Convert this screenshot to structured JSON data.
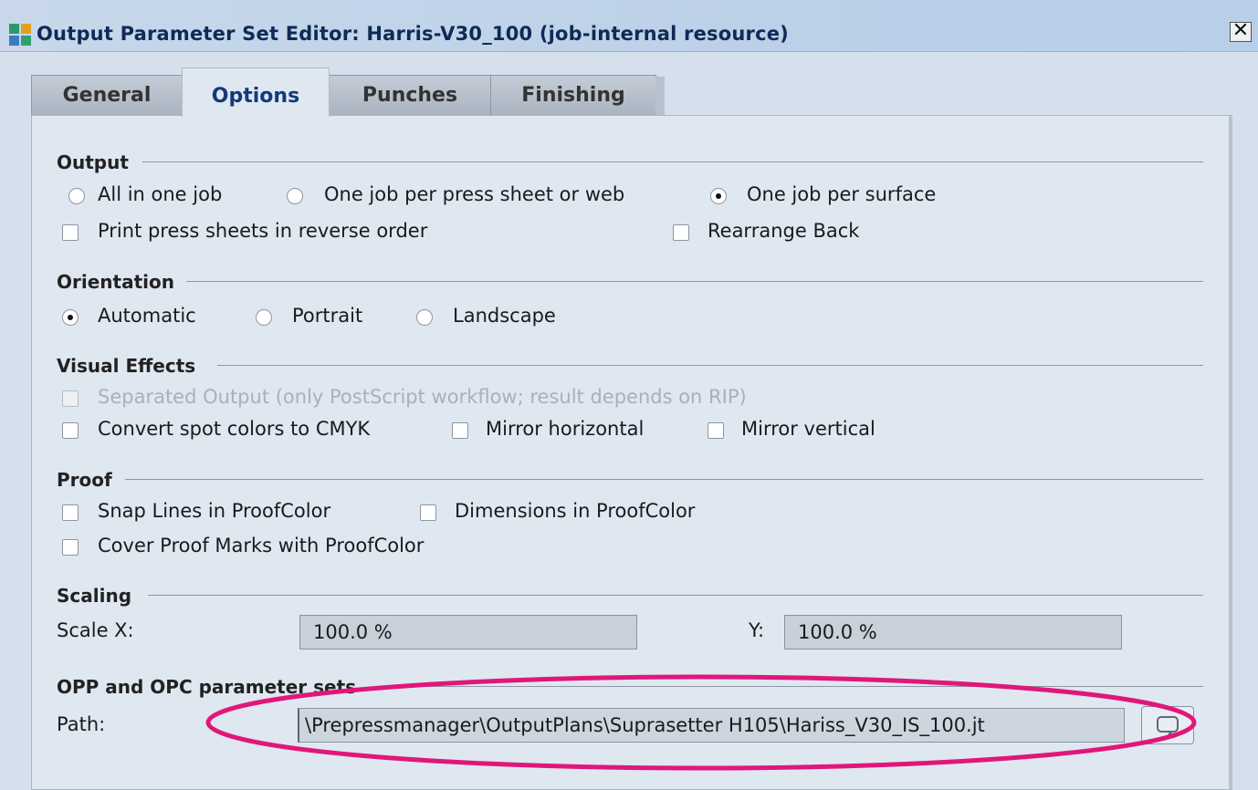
{
  "window": {
    "title": "Output Parameter Set Editor: Harris-V30_100 (job-internal resource)",
    "close_label": "✕"
  },
  "tabs": [
    {
      "label": "General",
      "active": false
    },
    {
      "label": "Options",
      "active": true
    },
    {
      "label": "Punches",
      "active": false
    },
    {
      "label": "Finishing",
      "active": false
    }
  ],
  "output": {
    "title": "Output",
    "radio_all_in_one": "All in one job",
    "radio_per_press_sheet": "One job per press sheet or web",
    "radio_per_surface": "One job per surface",
    "selected": "One job per surface",
    "check_reverse_order": "Print press sheets in reverse order",
    "check_rearrange_back": "Rearrange Back"
  },
  "orientation": {
    "title": "Orientation",
    "radio_automatic": "Automatic",
    "radio_portrait": "Portrait",
    "radio_landscape": "Landscape",
    "selected": "Automatic"
  },
  "visual_effects": {
    "title": "Visual Effects",
    "check_separated": "Separated Output (only PostScript workflow; result depends on RIP)",
    "check_convert_spot": "Convert spot colors to CMYK",
    "check_mirror_h": "Mirror horizontal",
    "check_mirror_v": "Mirror vertical"
  },
  "proof": {
    "title": "Proof",
    "check_snap_lines": "Snap Lines in ProofColor",
    "check_dimensions": "Dimensions in ProofColor",
    "check_cover_marks": "Cover Proof Marks with ProofColor"
  },
  "scaling": {
    "title": "Scaling",
    "x_label": "Scale X:",
    "x_value": "100.0 %",
    "y_label": "Y:",
    "y_value": "100.0 %"
  },
  "opp": {
    "title": "OPP and OPC parameter sets",
    "path_label": "Path:",
    "path_value": "\\Prepressmanager\\OutputPlans\\Suprasetter H105\\Hariss_V30_IS_100.jt"
  },
  "colors": {
    "highlight": "#e0177a",
    "tab_active_text": "#123a7a",
    "title_text": "#0e2a56"
  }
}
